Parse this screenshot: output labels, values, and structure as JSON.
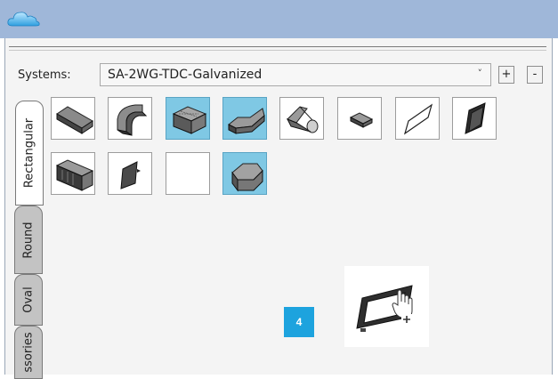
{
  "systems": {
    "label": "Systems:",
    "selected": "SA-2WG-TDC-Galvanized",
    "add_label": "+",
    "remove_label": "-"
  },
  "tabs": [
    {
      "label": "Rectangular",
      "active": true
    },
    {
      "label": "Round",
      "active": false
    },
    {
      "label": "Oval",
      "active": false
    },
    {
      "label": "ssories",
      "active": false
    }
  ],
  "fittings": [
    {
      "name": "straight-duct",
      "selected": false
    },
    {
      "name": "elbow",
      "selected": false
    },
    {
      "name": "grille-box",
      "selected": true
    },
    {
      "name": "transition",
      "selected": true
    },
    {
      "name": "square-to-round",
      "selected": false
    },
    {
      "name": "register",
      "selected": false
    },
    {
      "name": "flat-plate",
      "selected": false
    },
    {
      "name": "access-door",
      "selected": false
    },
    {
      "name": "lined-duct",
      "selected": false
    },
    {
      "name": "damper",
      "selected": false
    },
    {
      "name": "empty",
      "selected": false
    },
    {
      "name": "offset",
      "selected": true
    }
  ],
  "step_badge": "4",
  "colors": {
    "accent": "#1da3de",
    "selected_tile": "#7fc8e4",
    "titlebar": "#9fb7d9"
  }
}
